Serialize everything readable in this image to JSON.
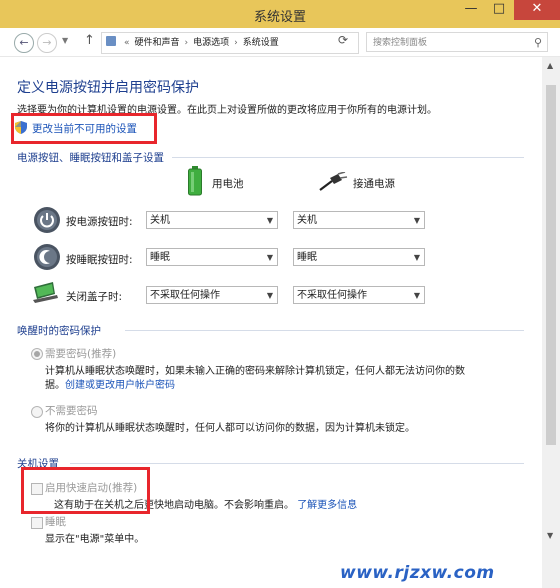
{
  "window": {
    "title": "系统设置",
    "minimize": "—",
    "maximize": "□",
    "close": "✕"
  },
  "address": {
    "crumbs": [
      "硬件和声音",
      "电源选项",
      "系统设置"
    ],
    "search_placeholder": "搜索控制面板"
  },
  "main": {
    "heading": "定义电源按钮并启用密码保护",
    "description": "选择要为你的计算机设置的电源设置。在此页上对设置所做的更改将应用于你所有的电源计划。",
    "change_link": "更改当前不可用的设置"
  },
  "power_buttons": {
    "section_title": "电源按钮、睡眠按钮和盖子设置",
    "col_battery": "用电池",
    "col_plugged": "接通电源",
    "rows": [
      {
        "label": "按电源按钮时:",
        "battery": "关机",
        "plugged": "关机"
      },
      {
        "label": "按睡眠按钮时:",
        "battery": "睡眠",
        "plugged": "睡眠"
      },
      {
        "label": "关闭盖子时:",
        "battery": "不采取任何操作",
        "plugged": "不采取任何操作"
      }
    ]
  },
  "password": {
    "section_title": "唤醒时的密码保护",
    "require_label": "需要密码(推荐)",
    "require_desc": "计算机从睡眠状态唤醒时，如果未输入正确的密码来解除计算机锁定，任何人都无法访问你的数",
    "require_desc2": "据。",
    "require_link": "创建或更改用户帐户密码",
    "norequire_label": "不需要密码",
    "norequire_desc": "将你的计算机从睡眠状态唤醒时，任何人都可以访问你的数据，因为计算机未锁定。"
  },
  "shutdown": {
    "section_title": "关机设置",
    "fast_startup_label": "启用快速启动(推荐)",
    "fast_startup_desc": "这有助于在关机之后更快地启动电脑。不会影响重启。",
    "learn_more": "了解更多信息",
    "sleep_label": "睡眠",
    "sleep_desc": "显示在\"电源\"菜单中。"
  },
  "watermark": "www.rjzxw.com",
  "colors": {
    "title_bar": "#e8c65a",
    "close_button": "#c7463c",
    "highlight": "#e8262c",
    "link": "#1a53b8",
    "heading": "#1e3f8f"
  }
}
